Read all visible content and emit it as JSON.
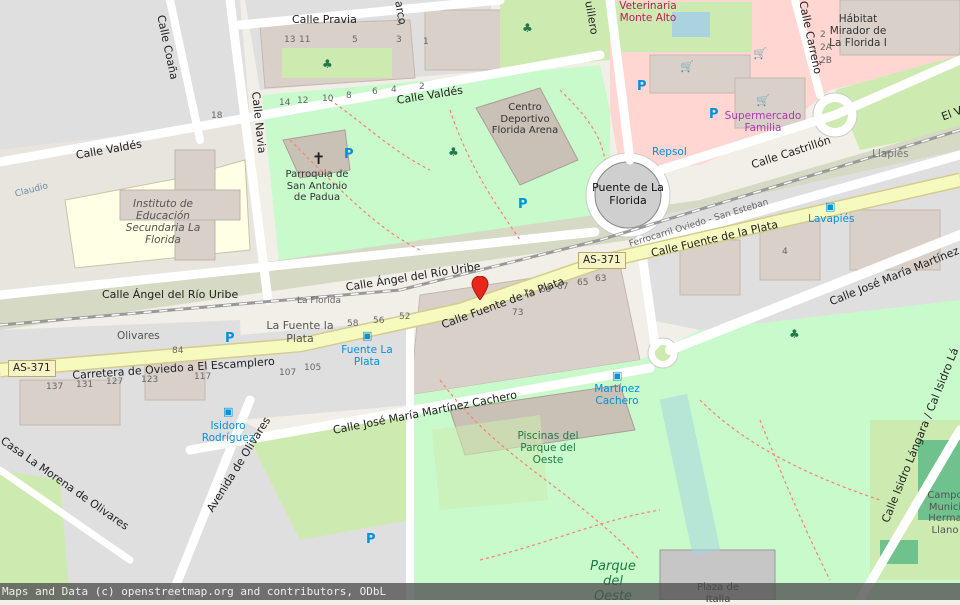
{
  "map": {
    "colors": {
      "background": "#f2efe9",
      "park": "#c8facc",
      "grass": "#cdebb0",
      "wood": "#add19e",
      "school": "#ffffe5",
      "residential": "#e0dfdf",
      "building": "#d9d0c9",
      "retail": "#ffd6d1",
      "railway": "#999999",
      "primary_road": "#f7fabf",
      "road": "#ffffff",
      "footpath": "#fa8072",
      "water": "#aad3df"
    },
    "marker_icon": "map-pin-icon"
  },
  "streets": {
    "calle_pravia": "Calle Pravia",
    "calle_coana": "Calle Coaña",
    "calle_valdes_top": "Calle Valdés",
    "calle_valdes_left": "Calle Valdés",
    "calle_navia": "Calle Navia",
    "calle_carreno": "Calle Carreño",
    "calle_castrillon": "Calle Castrillón",
    "calle_angel_right": "Calle Ángel del Río Uribe",
    "calle_angel_left": "Calle Ángel del Río Uribe",
    "calle_fuente_plata_main": "Calle Fuente de la Plata",
    "calle_fuente_plata_right": "Calle Fuente de la Plata",
    "calle_jose_maria_right": "Calle José María Martínez Ca",
    "calle_jose_maria_main": "Calle José María Martínez Cachero",
    "carretera": "Carretera de Oviedo a El Escamplero",
    "avenida_olivares": "Avenida de Olivares",
    "casa_morena": "Casa La Morena de Olivares",
    "calle_isidro": "Calle Isidro Lángara / Cal Isidro Lá",
    "ferrocarril": "Ferrocarril Oviedo - San Esteban",
    "la_florida_rail": "La Florida",
    "claudio": "Claudio",
    "el_v": "El V",
    "carro": "arco",
    "cuillero": "uillero"
  },
  "shields": {
    "as371_left": "AS-371",
    "as371_right": "AS-371"
  },
  "places": {
    "instituto": "Instituto de Educación Secundaria La Florida",
    "parroquia": "Parroquia de San Antonio de Padua",
    "centro_deportivo": "Centro Deportivo Florida Arena",
    "puente_florida": "Puente de La Florida",
    "veterinaria": "Veterinaria Monte Alto",
    "habitat": "Hábitat Mirador de La Florida I",
    "supermercado": "Supermercado Familia",
    "repsol": "Repsol",
    "llapies": "Llapiés",
    "lavapies": "Lavapiés",
    "fuente_plata_place": "La Fuente la Plata",
    "olivares": "Olivares",
    "fuente_plata_bus": "Fuente La Plata",
    "isidoro": "Isidoro Rodríguez",
    "martinez_cachero": "Martínez Cachero",
    "piscinas": "Piscinas del Parque del Oeste",
    "parque_oeste": "Parque del Oeste",
    "plaza_italia": "Plaza de Italia",
    "campo": "Campo Munici Herma Llano"
  },
  "house_numbers": [
    "3",
    "13",
    "11",
    "5",
    "3",
    "1",
    "14",
    "12",
    "10",
    "8",
    "6",
    "4",
    "2",
    "18",
    "2",
    "2A",
    "2B",
    "4",
    "71",
    "69",
    "67",
    "65",
    "63",
    "73",
    "58",
    "56",
    "52",
    "84",
    "137",
    "131",
    "127",
    "123",
    "117",
    "107",
    "105"
  ],
  "attribution": "Maps and Data (c) openstreetmap.org and contributors, ODbL"
}
